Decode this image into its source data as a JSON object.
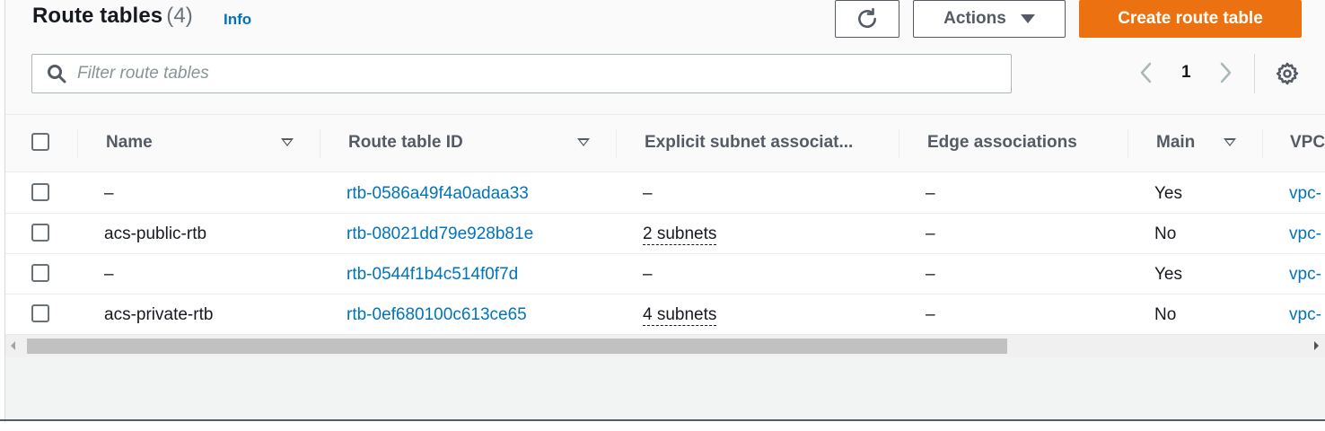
{
  "header": {
    "title": "Route tables",
    "count": "(4)",
    "info_label": "Info"
  },
  "toolbar": {
    "actions_label": "Actions",
    "create_label": "Create route table"
  },
  "search": {
    "placeholder": "Filter route tables",
    "value": ""
  },
  "pagination": {
    "current_page": "1"
  },
  "table": {
    "columns": [
      "Name",
      "Route table ID",
      "Explicit subnet associat...",
      "Edge associations",
      "Main",
      "VPC"
    ],
    "rows": [
      {
        "name": "–",
        "route_table_id": "rtb-0586a49f4a0adaa33",
        "subnet_assoc": "–",
        "edge_assoc": "–",
        "main": "Yes",
        "vpc": "vpc-"
      },
      {
        "name": "acs-public-rtb",
        "route_table_id": "rtb-08021dd79e928b81e",
        "subnet_assoc": "2 subnets",
        "edge_assoc": "–",
        "main": "No",
        "vpc": "vpc-"
      },
      {
        "name": "–",
        "route_table_id": "rtb-0544f1b4c514f0f7d",
        "subnet_assoc": "–",
        "edge_assoc": "–",
        "main": "Yes",
        "vpc": "vpc-"
      },
      {
        "name": "acs-private-rtb",
        "route_table_id": "rtb-0ef680100c613ce65",
        "subnet_assoc": "4 subnets",
        "edge_assoc": "–",
        "main": "No",
        "vpc": "vpc-"
      }
    ]
  },
  "colors": {
    "primary_button": "#ec7211",
    "link": "#0073bb",
    "text": "#16191f"
  },
  "icons": [
    "refresh-icon",
    "caret-down-icon",
    "search-icon",
    "chevron-left-icon",
    "chevron-right-icon",
    "gear-icon",
    "sort-icon"
  ]
}
